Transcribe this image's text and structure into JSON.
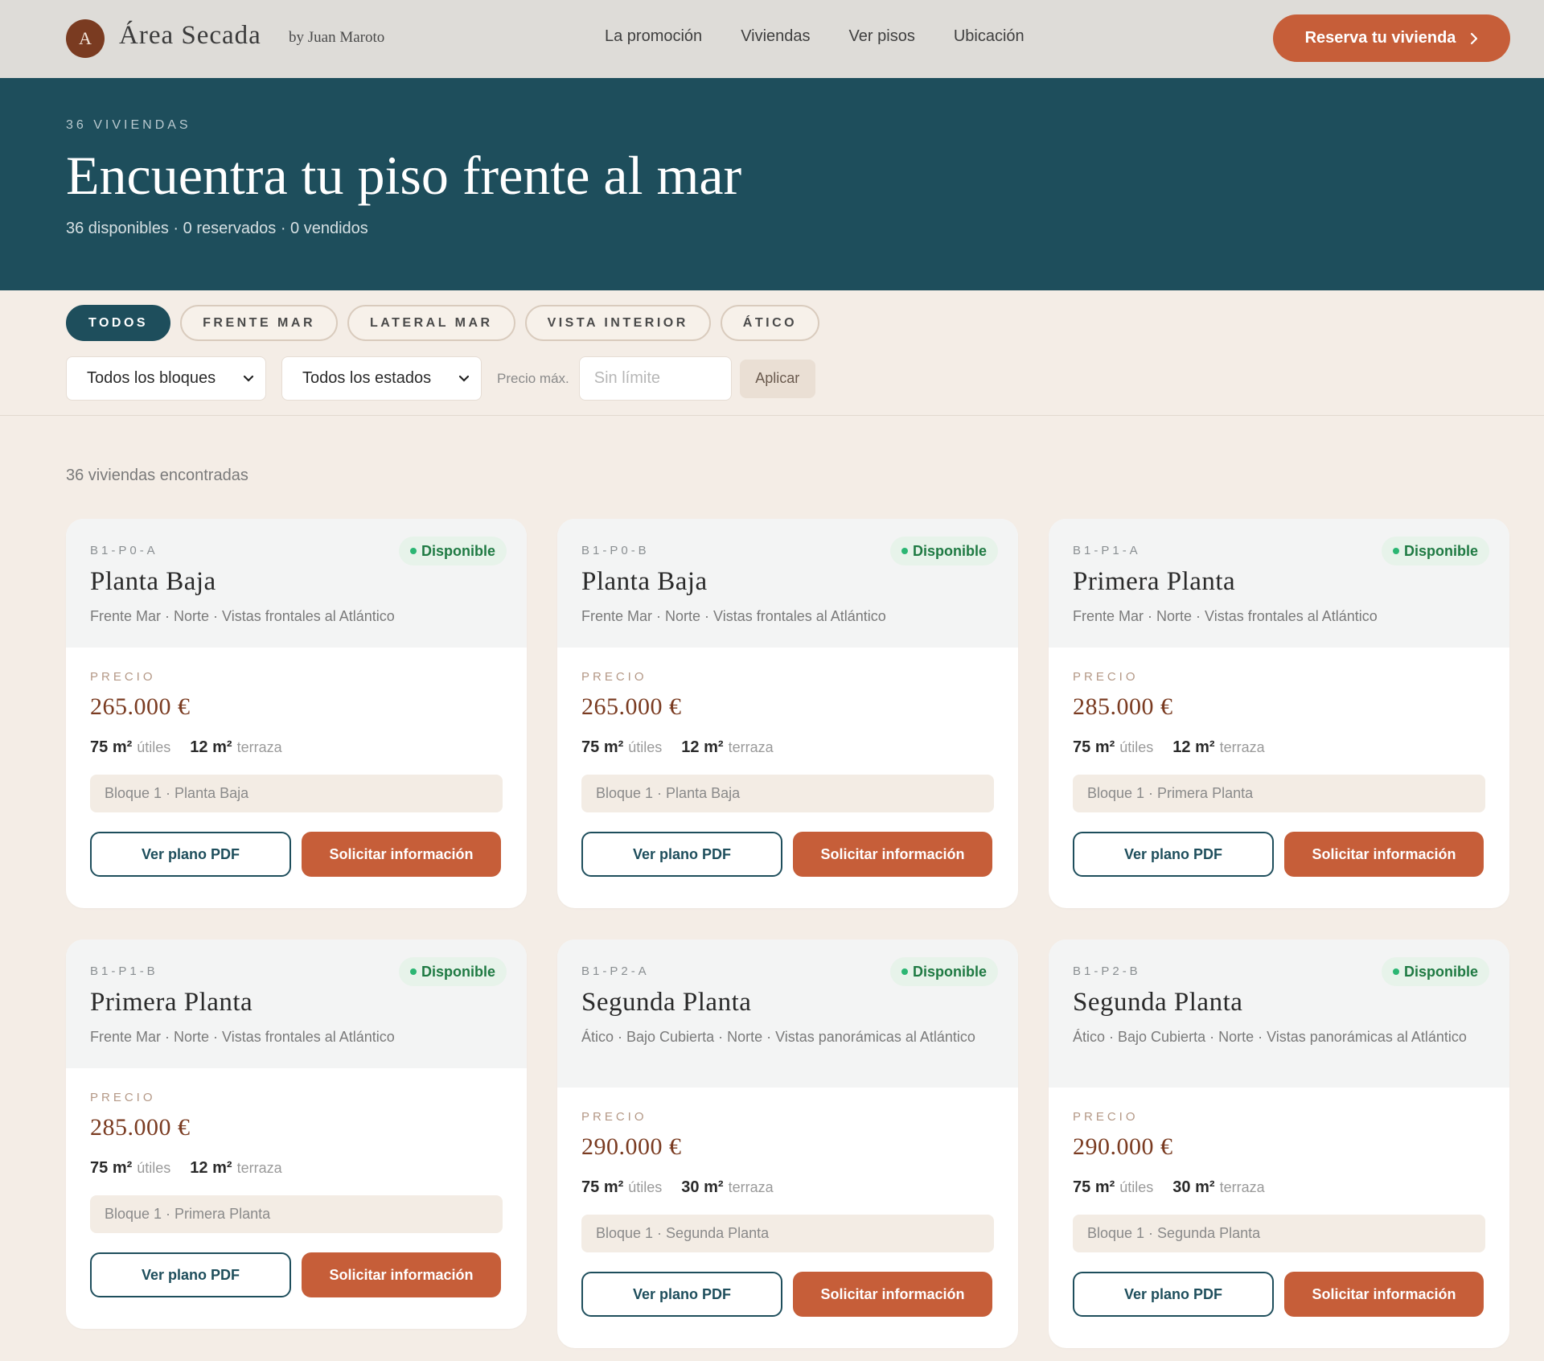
{
  "header": {
    "logo_letter": "A",
    "brand": "Área Secada",
    "by": "by Juan Maroto",
    "nav": [
      "La promoción",
      "Viviendas",
      "Ver pisos",
      "Ubicación"
    ],
    "cta": "Reserva tu vivienda",
    "cta_icon": "chevron-right-icon"
  },
  "hero": {
    "kicker": "36 VIVIENDAS",
    "title": "Encuentra tu piso frente al mar",
    "subtitle": "36 disponibles · 0 reservados · 0 vendidos"
  },
  "filters": {
    "chips": [
      "TODOS",
      "FRENTE MAR",
      "LATERAL MAR",
      "VISTA INTERIOR",
      "ÁTICO"
    ],
    "active_chip": "TODOS",
    "block_select": "Todos los bloques",
    "status_select": "Todos los estados",
    "price_label": "Precio máx.",
    "price_placeholder": "Sin límite",
    "apply": "Aplicar"
  },
  "results": {
    "count_text": "36 viviendas encontradas",
    "labels": {
      "price_kicker": "PRECIO",
      "unit": "m²",
      "useful": "útiles",
      "terrace": "terraza",
      "pdf_button": "Ver plano PDF",
      "info_button": "Solicitar información"
    },
    "cards": [
      {
        "code": "B1-P0-A",
        "status": "Disponible",
        "title": "Planta Baja",
        "desc": "Frente Mar · Norte · Vistas frontales al Atlántico",
        "price": "265.000 €",
        "useful": "75",
        "terrace": "12",
        "location": "Bloque 1 · Planta Baja"
      },
      {
        "code": "B1-P0-B",
        "status": "Disponible",
        "title": "Planta Baja",
        "desc": "Frente Mar · Norte · Vistas frontales al Atlántico",
        "price": "265.000 €",
        "useful": "75",
        "terrace": "12",
        "location": "Bloque 1 · Planta Baja"
      },
      {
        "code": "B1-P1-A",
        "status": "Disponible",
        "title": "Primera Planta",
        "desc": "Frente Mar · Norte · Vistas frontales al Atlántico",
        "price": "285.000 €",
        "useful": "75",
        "terrace": "12",
        "location": "Bloque 1 · Primera Planta"
      },
      {
        "code": "B1-P1-B",
        "status": "Disponible",
        "title": "Primera Planta",
        "desc": "Frente Mar · Norte · Vistas frontales al Atlántico",
        "price": "285.000 €",
        "useful": "75",
        "terrace": "12",
        "location": "Bloque 1 · Primera Planta"
      },
      {
        "code": "B1-P2-A",
        "status": "Disponible",
        "title": "Segunda Planta",
        "desc": "Ático · Bajo Cubierta · Norte · Vistas panorámicas al Atlántico",
        "price": "290.000 €",
        "useful": "75",
        "terrace": "30",
        "location": "Bloque 1 · Segunda Planta"
      },
      {
        "code": "B1-P2-B",
        "status": "Disponible",
        "title": "Segunda Planta",
        "desc": "Ático · Bajo Cubierta · Norte · Vistas panorámicas al Atlántico",
        "price": "290.000 €",
        "useful": "75",
        "terrace": "30",
        "location": "Bloque 1 · Segunda Planta"
      }
    ]
  },
  "colors": {
    "brand_dark": "#1e4e5c",
    "accent": "#c65e39",
    "price": "#7a3b21",
    "available": "#1f7a43",
    "background": "#f4ede6"
  }
}
